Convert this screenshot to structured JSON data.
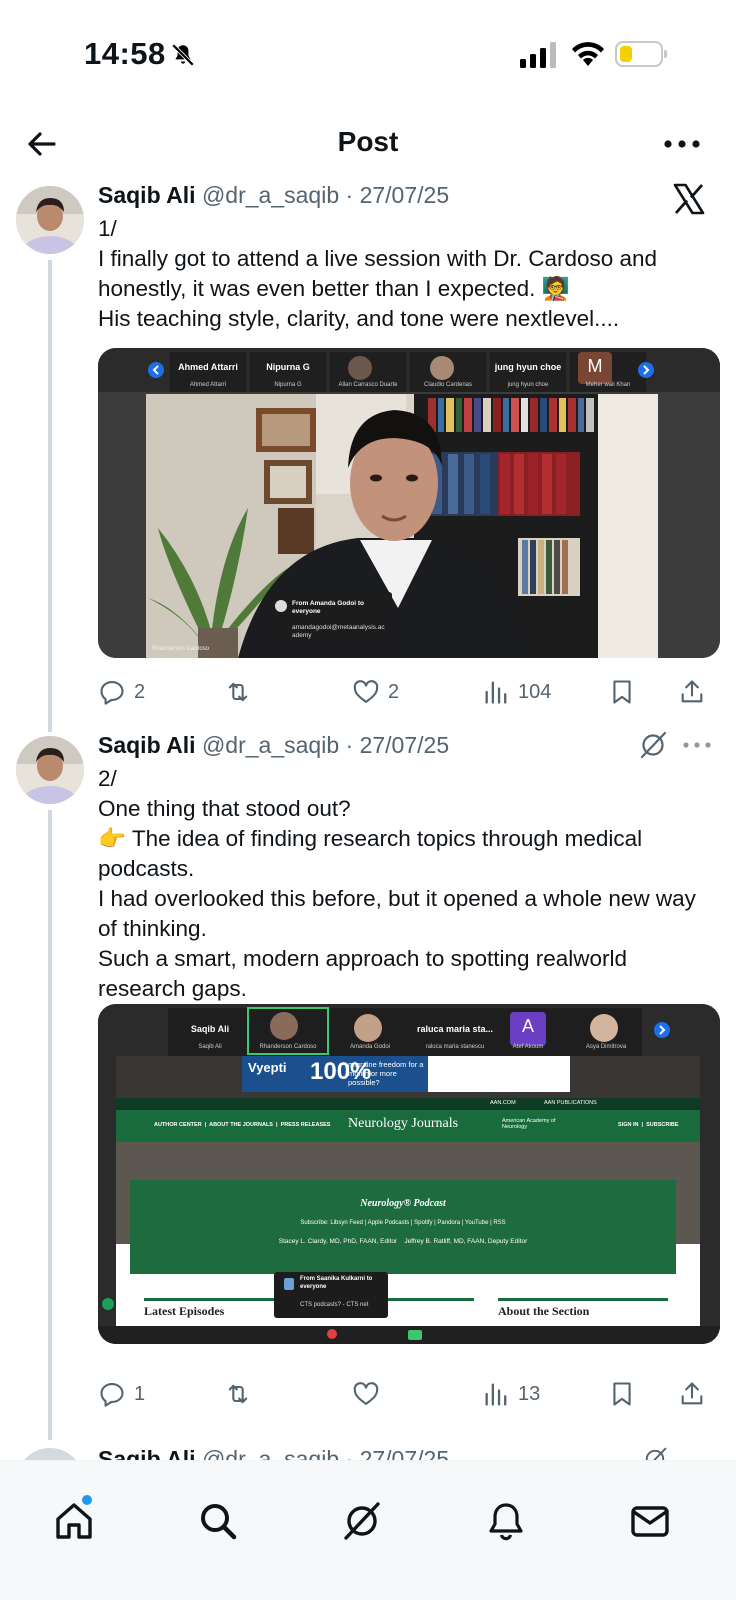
{
  "status_bar": {
    "time": "14:58"
  },
  "header": {
    "title": "Post"
  },
  "tweets": [
    {
      "name": "Saqib Ali",
      "handle": "@dr_a_saqib",
      "separator": "·",
      "date": "27/07/25",
      "lines": [
        "1/",
        "I finally got to attend a live session with Dr. Cardoso and honestly, it was even better than I expected. 🧑‍🏫",
        "His teaching style, clarity, and tone were nextlevel...."
      ],
      "media": {
        "participants": [
          {
            "name": "Ahmed Attarri",
            "sub": "Ahmed Attarri"
          },
          {
            "name": "Nipurna G",
            "sub": "Nipurna G"
          },
          {
            "name": "",
            "sub": "Allan Carrasco Duarte"
          },
          {
            "name": "",
            "sub": "Claudio Cardenas"
          },
          {
            "name": "jung hyun choe",
            "sub": "jung hyun choe"
          },
          {
            "name": "M",
            "sub": "Meher wali Khan"
          }
        ],
        "chat_from": "From Amanda Godoi to everyone",
        "chat_msg": "amandagodoi@metaanalysis.academy",
        "speaker_label": "Rhanderson Cardoso"
      },
      "stats": {
        "replies": "2",
        "retweets": "",
        "likes": "2",
        "views": "104"
      }
    },
    {
      "name": "Saqib Ali",
      "handle": "@dr_a_saqib",
      "separator": "·",
      "date": "27/07/25",
      "lines": [
        "2/",
        "One thing that stood out?",
        "👉 The idea of finding research topics through medical podcasts.",
        "I had overlooked this before, but it opened a whole new way of thinking.",
        "Such a smart, modern approach to spotting realworld research gaps."
      ],
      "media": {
        "participants": [
          {
            "name": "Saqib Ali",
            "sub": "Saqib Ali"
          },
          {
            "name": "",
            "sub": "Rhanderson Cardoso"
          },
          {
            "name": "",
            "sub": "Amanda Godoi"
          },
          {
            "name": "raluca maria sta...",
            "sub": "raluca maria stanescu"
          },
          {
            "name": "A",
            "sub": "Atef Akoum"
          },
          {
            "name": "",
            "sub": "Asya Dimitrova"
          }
        ],
        "ad_brand": "Vyepti",
        "ad_big": "100%",
        "ad_text": "migraine freedom for a month or more possible?",
        "site_top": "AAN.COM",
        "site_pubs": "AAN PUBLICATIONS",
        "nav_links": "AUTHOR CENTER  |  ABOUT THE JOURNALS  |  PRESS RELEASES",
        "site_name": "Neurology Journals",
        "academy": "American Academy of Neurology",
        "sign_in": "SIGN IN  |  SUBSCRIBE",
        "podcast_title": "Neurology® Podcast",
        "subscribe_line": "Subscribe: Libsyn Feed | Apple Podcasts | Spotify | Pandora | YouTube | RSS",
        "editors": "Stacey L. Clardy, MD, PhD, FAAN, Editor    Jeffrey B. Ratliff, MD, FAAN, Deputy Editor",
        "latest": "Latest Episodes",
        "about": "About the Section",
        "chat_from": "From Saanika Kulkarni to everyone",
        "chat_msg": "CTS podcasts? - CTS net"
      },
      "stats": {
        "replies": "1",
        "retweets": "",
        "likes": "",
        "views": "13"
      }
    },
    {
      "name": "Saqib Ali",
      "handle": "@dr_a_saqib",
      "separator": "·",
      "date": "27/07/25"
    }
  ],
  "icons": {
    "accent": "#1d9bf0",
    "grey": "#536471",
    "thread_line": "#cfd9de"
  }
}
